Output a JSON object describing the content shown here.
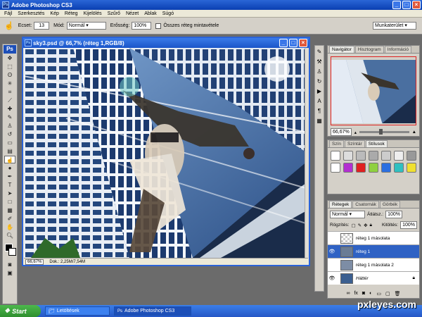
{
  "window": {
    "title": "Adobe Photoshop CS3",
    "icon": "Ps"
  },
  "menu": [
    "Fájl",
    "Szerkesztés",
    "Kép",
    "Réteg",
    "Kijelölés",
    "Szűrő",
    "Nézet",
    "Ablak",
    "Súgó"
  ],
  "options": {
    "ecset_label": "Ecset:",
    "ecset_size": "13",
    "mod_label": "Mód:",
    "mod_value": "Normál",
    "erosseg_label": "Erősség:",
    "erosseg_value": "100%",
    "sample_all": "Összes réteg mintavétele",
    "workspace": "Munkaterület"
  },
  "document": {
    "title": "sky3.psd @ 66,7% (réteg 1,RGB/8)",
    "zoom": "66,67%",
    "doc_info": "Dok.: 2,25M/7,54M"
  },
  "navigator": {
    "tabs": [
      "Navigátor",
      "Hisztogram",
      "Információ"
    ],
    "zoom": "66,67%"
  },
  "styles": {
    "tabs": [
      "Szín",
      "Színtár",
      "Stílusok"
    ]
  },
  "layers": {
    "tabs": [
      "Rétegek",
      "Csatornák",
      "Görbék"
    ],
    "blend": "Normál",
    "opacity_label": "Átlátsz.:",
    "opacity": "100%",
    "lock_label": "Rögzítés:",
    "fill_label": "Kitöltés:",
    "fill": "100%",
    "items": [
      {
        "name": "réteg 1 másolata",
        "visible": false,
        "active": false
      },
      {
        "name": "réteg 1",
        "visible": true,
        "active": true
      },
      {
        "name": "réteg 1 másolata 2",
        "visible": false,
        "active": false
      },
      {
        "name": "Háttér",
        "visible": true,
        "active": false
      }
    ]
  },
  "taskbar": {
    "start": "Start",
    "items": [
      "Letöltések",
      "Adobe Photoshop CS3"
    ]
  },
  "watermark": "pxleyes.com",
  "colors": {
    "xp_blue": "#2a66d6",
    "active_layer": "#2f62c4",
    "start_green": "#3a9b3a"
  }
}
